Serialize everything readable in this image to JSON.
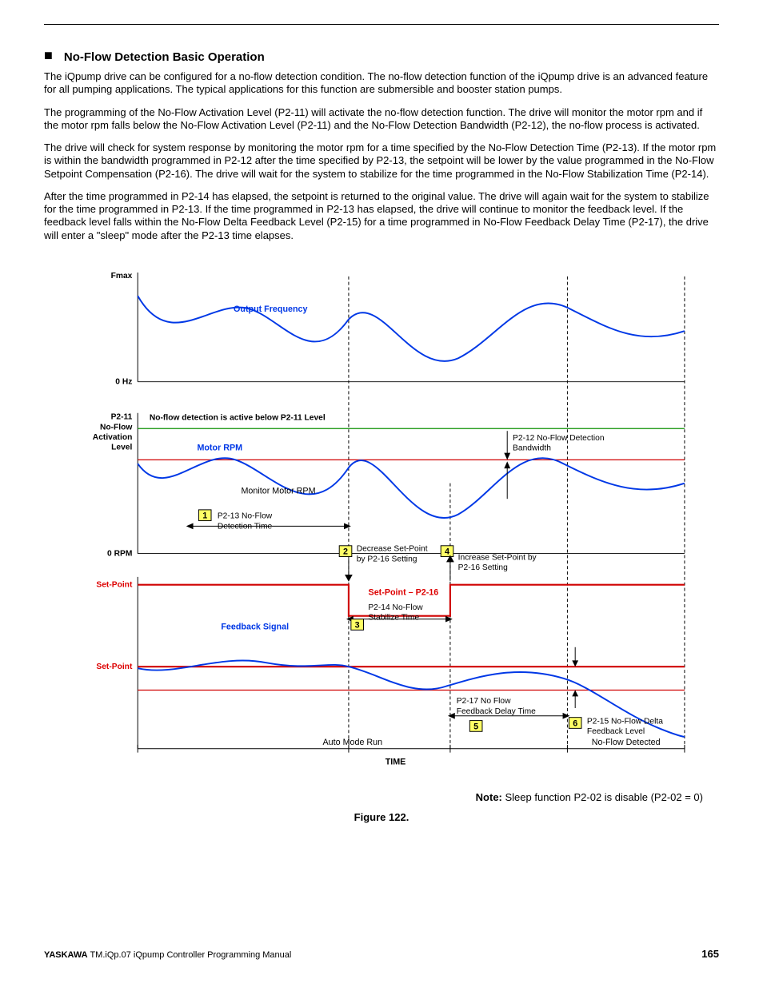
{
  "heading": "No-Flow Detection Basic Operation",
  "paragraphs": {
    "p1": "The iQpump drive can be configured for a no-flow detection condition. The no-flow detection function of the iQpump drive is an advanced feature for all pumping applications. The typical applications for this function are submersible and booster station pumps.",
    "p2": "The programming of the No-Flow Activation Level (P2-11) will activate the no-flow detection function. The drive will monitor the motor rpm and if the motor rpm falls below the No-Flow Activation Level (P2-11) and the No-Flow Detection Bandwidth (P2-12), the no-flow process is activated.",
    "p3": "The drive will check for system response by monitoring the motor rpm for a time specified by the No-Flow Detection Time (P2-13). If the motor rpm is within the bandwidth programmed in P2-12 after the time specified by P2-13, the setpoint will be lower by the value programmed in the No-Flow Setpoint Compensation (P2-16). The drive will wait for the system to stabilize for the time programmed in the No-Flow Stabilization Time (P2-14).",
    "p4": "After the time programmed in P2-14 has elapsed, the setpoint is returned to the original value. The drive will again wait for the system to stabilize for the time programmed in P2-13. If the time programmed in P2-13 has elapsed, the drive will continue to monitor the feedback level. If the feedback level falls within the No-Flow Delta Feedback Level (P2-15) for a time programmed in No-Flow Feedback Delay Time (P2-17), the drive will enter a \"sleep\" mode after the P2-13 time elapses."
  },
  "diagram": {
    "yLabels": {
      "fmax": "Fmax",
      "zeroHz": "0 Hz",
      "p211a": "P2-11",
      "p211b": "No-Flow",
      "p211c": "Activation",
      "p211d": "Level",
      "zeroRpm": "0 RPM",
      "sp1": "Set-Point",
      "sp2": "Set-Point"
    },
    "labels": {
      "outFreq": "Output Frequency",
      "noFlowActive": "No-flow detection is active below P2-11 Level",
      "motorRpm": "Motor RPM",
      "monitorRpm": "Monitor Motor RPM",
      "p212a": "P2-12 No-Flow Detection",
      "p212b": "Bandwidth",
      "p213a": "P2-13 No-Flow",
      "p213b": "Detection Time",
      "decA": "Decrease Set-Point",
      "decB": "by P2-16 Setting",
      "incA": "Increase Set-Point by",
      "incB": "P2-16 Setting",
      "spMinus": "Set-Point – P2-16",
      "p214a": "P2-14 No-Flow",
      "p214b": "Stabilize Time",
      "feedback": "Feedback Signal",
      "p217a": "P2-17 No Flow",
      "p217b": "Feedback Delay Time",
      "p215a": "P2-15 No-Flow Delta",
      "p215b": "Feedback Level",
      "autoRun": "Auto Mode Run",
      "noFlowDet": "No-Flow Detected",
      "time": "TIME"
    },
    "numbers": {
      "n1": "1",
      "n2": "2",
      "n3": "3",
      "n4": "4",
      "n5": "5",
      "n6": "6"
    }
  },
  "noteBold": "Note:",
  "noteText": " Sleep function P2-02 is disable (P2-02 = 0)",
  "figureCaption": "Figure 122.",
  "footer": {
    "brand": "YASKAWA",
    "doc": " TM.iQp.07 iQpump Controller Programming Manual",
    "page": "165"
  }
}
